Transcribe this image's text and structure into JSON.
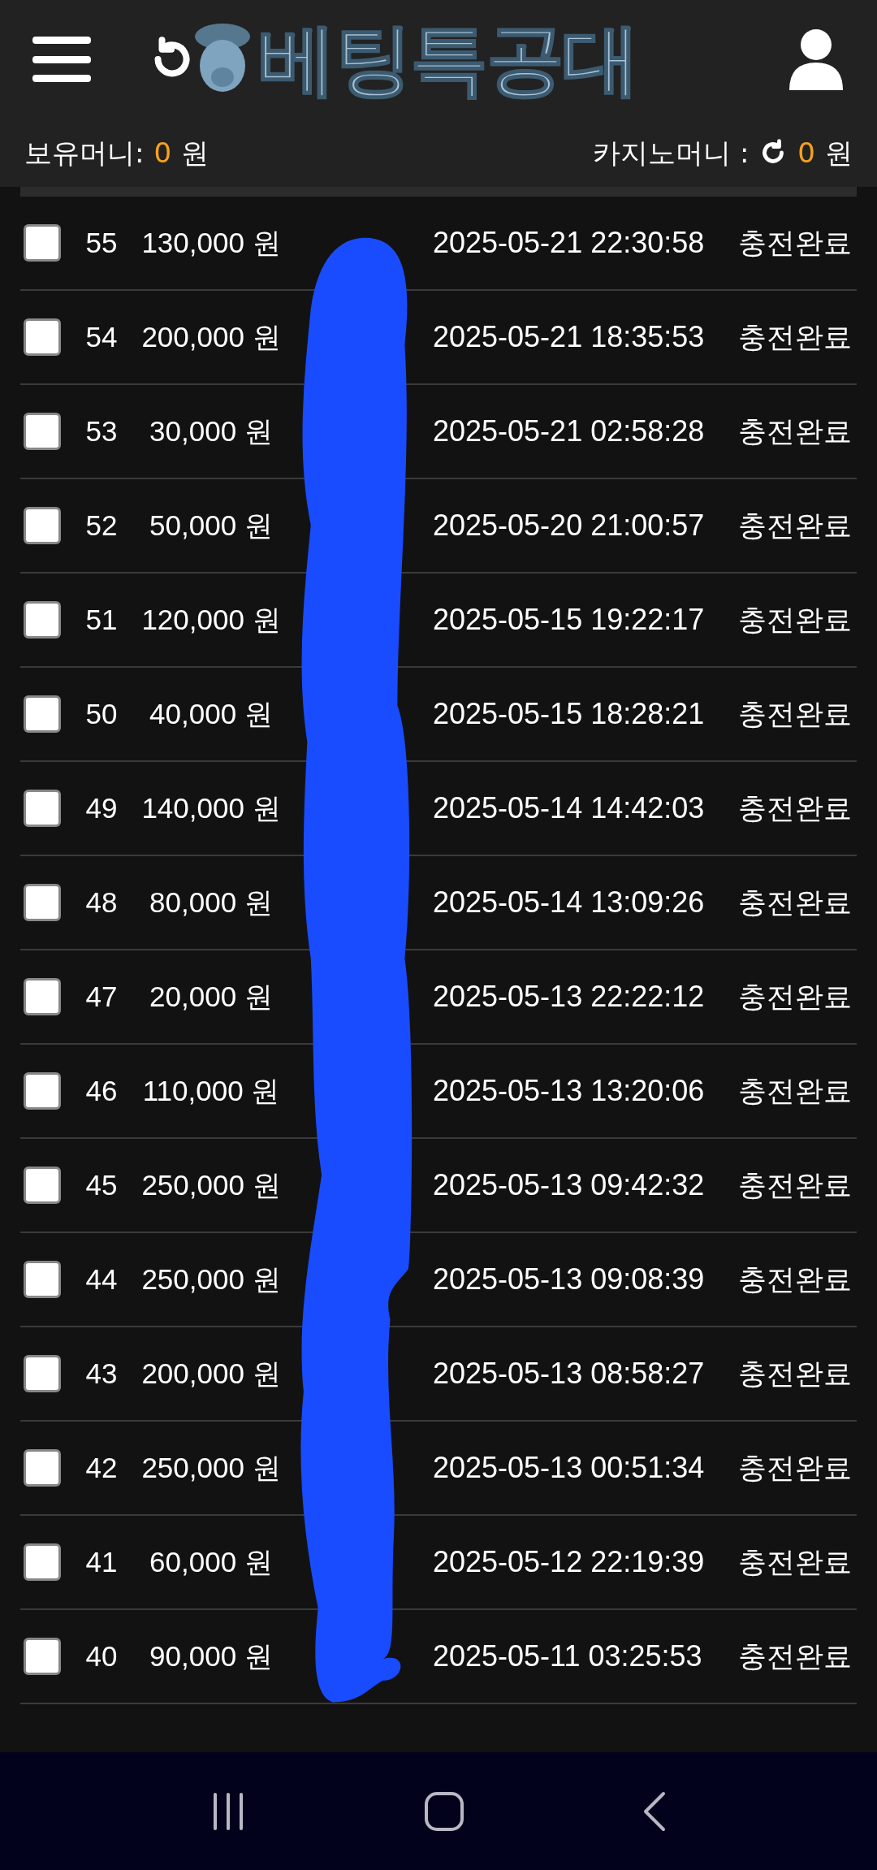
{
  "header": {
    "logo_text": "베팅특공대"
  },
  "balance": {
    "label": "보유머니:",
    "amount": "0",
    "unit": "원"
  },
  "casino_balance": {
    "label": "카지노머니 :",
    "amount": "0",
    "unit": "원"
  },
  "rows": [
    {
      "number": "55",
      "amount": "130,000 원",
      "datetime": "2025-05-21 22:30:58",
      "status": "충전완료",
      "checked": false
    },
    {
      "number": "54",
      "amount": "200,000 원",
      "datetime": "2025-05-21 18:35:53",
      "status": "충전완료",
      "checked": false
    },
    {
      "number": "53",
      "amount": "30,000 원",
      "datetime": "2025-05-21 02:58:28",
      "status": "충전완료",
      "checked": false
    },
    {
      "number": "52",
      "amount": "50,000 원",
      "datetime": "2025-05-20 21:00:57",
      "status": "충전완료",
      "checked": false
    },
    {
      "number": "51",
      "amount": "120,000 원",
      "datetime": "2025-05-15 19:22:17",
      "status": "충전완료",
      "checked": false
    },
    {
      "number": "50",
      "amount": "40,000 원",
      "datetime": "2025-05-15 18:28:21",
      "status": "충전완료",
      "checked": false
    },
    {
      "number": "49",
      "amount": "140,000 원",
      "datetime": "2025-05-14 14:42:03",
      "status": "충전완료",
      "checked": false
    },
    {
      "number": "48",
      "amount": "80,000 원",
      "datetime": "2025-05-14 13:09:26",
      "status": "충전완료",
      "checked": false
    },
    {
      "number": "47",
      "amount": "20,000 원",
      "datetime": "2025-05-13 22:22:12",
      "status": "충전완료",
      "checked": false
    },
    {
      "number": "46",
      "amount": "110,000 원",
      "datetime": "2025-05-13 13:20:06",
      "status": "충전완료",
      "checked": false
    },
    {
      "number": "45",
      "amount": "250,000 원",
      "datetime": "2025-05-13 09:42:32",
      "status": "충전완료",
      "checked": false
    },
    {
      "number": "44",
      "amount": "250,000 원",
      "datetime": "2025-05-13 09:08:39",
      "status": "충전완료",
      "checked": false
    },
    {
      "number": "43",
      "amount": "200,000 원",
      "datetime": "2025-05-13 08:58:27",
      "status": "충전완료",
      "checked": false
    },
    {
      "number": "42",
      "amount": "250,000 원",
      "datetime": "2025-05-13 00:51:34",
      "status": "충전완료",
      "checked": false
    },
    {
      "number": "41",
      "amount": "60,000 원",
      "datetime": "2025-05-12 22:19:39",
      "status": "충전완료",
      "checked": false
    },
    {
      "number": "40",
      "amount": "90,000 원",
      "datetime": "2025-05-11 03:25:53",
      "status": "충전완료",
      "checked": false
    }
  ]
}
